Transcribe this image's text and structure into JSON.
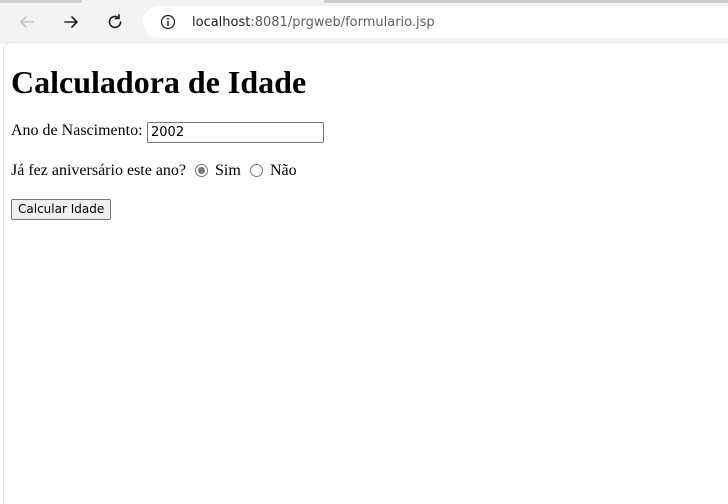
{
  "browser": {
    "url_host": "localhost",
    "url_rest": ":8081/prgweb/formulario.jsp"
  },
  "page": {
    "title": "Calculadora de Idade",
    "birth_year_label": "Ano de Nascimento:",
    "birth_year_value": "2002",
    "birthday_question": "Já fez aniversário este ano?",
    "radio_yes_label": "Sim",
    "radio_no_label": "Não",
    "selected_option": "Sim",
    "submit_label": "Calcular Idade"
  }
}
